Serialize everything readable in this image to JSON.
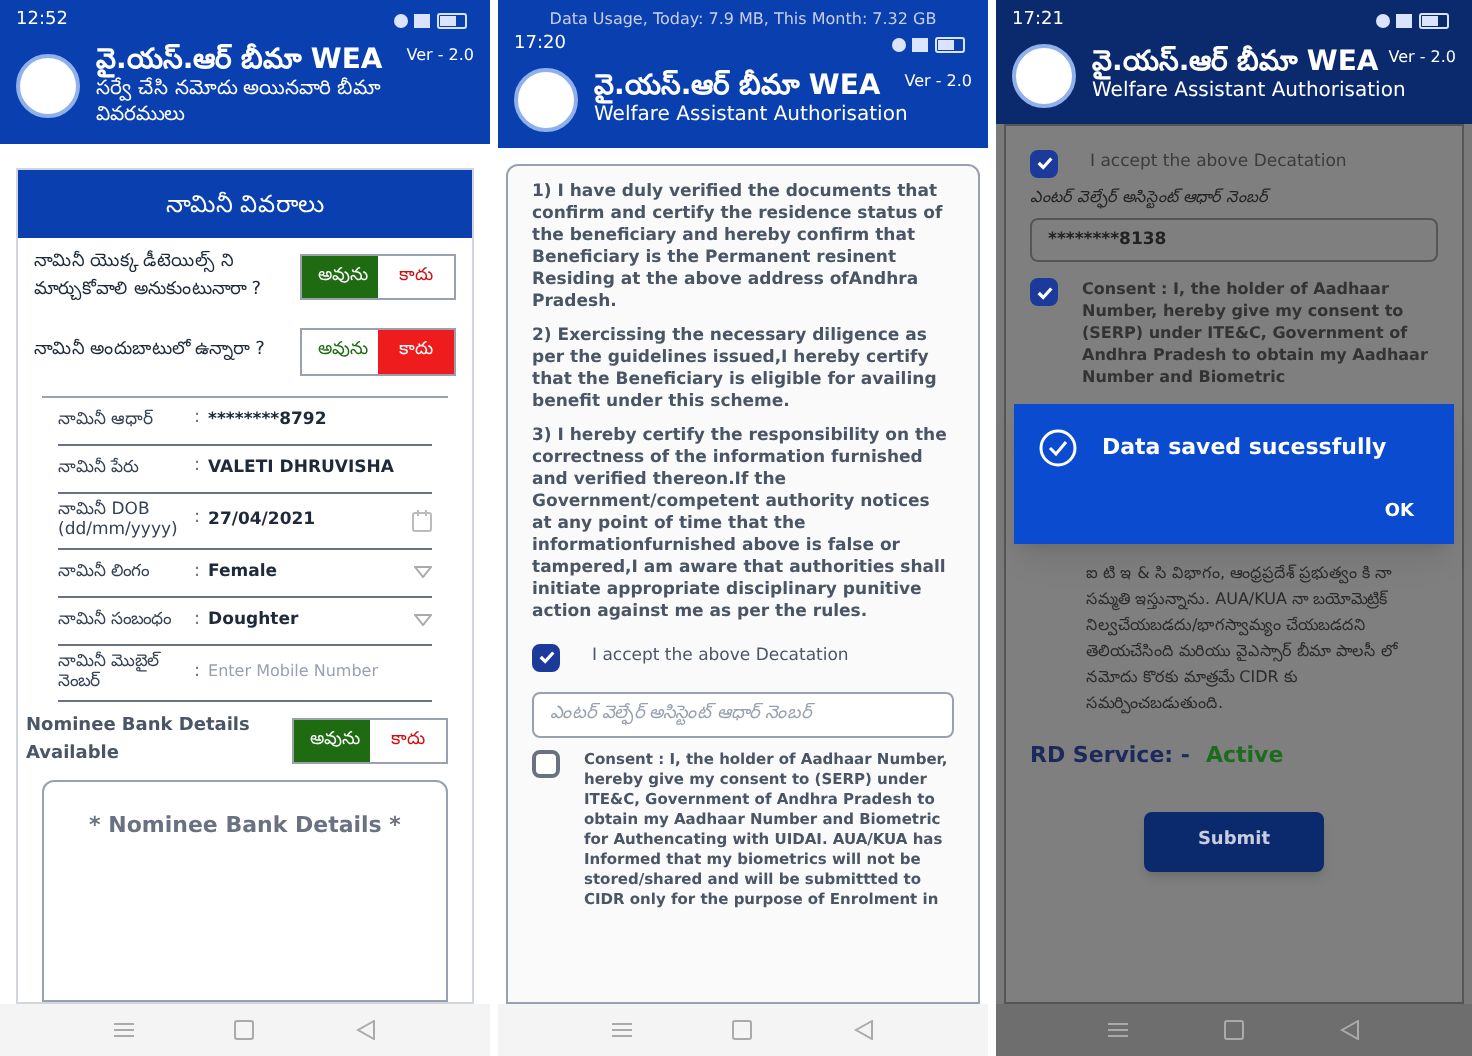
{
  "nominee_screen": {
    "status_time": "12:52",
    "header": {
      "title": "వై.యస్.ఆర్ బీమా WEA",
      "version": "Ver - 2.0",
      "subtitle": "సర్వే చేసి నమోదు అయినవారి బీమా వివరములు"
    },
    "card_title": "నామినీ వివరాలు",
    "questions": [
      {
        "text": "నామినీ యొక్క డీటెయిల్స్ ని మార్చుకోవాలి అనుకుంటునారా ?",
        "options": [
          {
            "label": "అవును",
            "kind": "yes",
            "selected": true
          },
          {
            "label": "కాదు",
            "kind": "no",
            "selected": false
          }
        ]
      },
      {
        "text": "నామినీ అందుబాటులో ఉన్నారా ?",
        "options": [
          {
            "label": "అవును",
            "kind": "yes",
            "selected": false
          },
          {
            "label": "కాదు",
            "kind": "no",
            "selected": true
          }
        ]
      }
    ],
    "fields": [
      {
        "label": "నామినీ ఆధార్",
        "separator": ":",
        "kind": "text",
        "value": "********8792"
      },
      {
        "label": "నామినీ పేరు",
        "separator": ":",
        "kind": "text",
        "value": "VALETI DHRUVISHA"
      },
      {
        "label": "నామినీ DOB (dd/mm/yyyy)",
        "separator": ":",
        "kind": "date",
        "value": "27/04/2021"
      },
      {
        "label": "నామినీ లింగం",
        "separator": ":",
        "kind": "dropdown",
        "value": "Female"
      },
      {
        "label": "నామినీ సంబంధం",
        "separator": ":",
        "kind": "dropdown",
        "value": "Doughter"
      },
      {
        "label": "నామినీ మొబైల్ నెంబర్",
        "separator": ":",
        "kind": "input",
        "placeholder": "Enter Mobile Number"
      }
    ],
    "bank_question": {
      "text": "Nominee Bank Details Available",
      "options": [
        {
          "label": "అవును",
          "kind": "yes",
          "selected": true
        },
        {
          "label": "కాదు",
          "kind": "no",
          "selected": false
        }
      ]
    },
    "bank_section_title": "* Nominee Bank Details *"
  },
  "declaration_screen": {
    "notification": "Data Usage, Today: 7.9 MB, This Month: 7.32 GB",
    "status_time": "17:20",
    "header": {
      "title": "వై.యస్.ఆర్ బీమా WEA",
      "version": "Ver - 2.0",
      "subtitle": "Welfare Assistant Authorisation"
    },
    "paragraphs": [
      "1) I have duly verified the documents that confirm and certify the residence status of the beneficiary and hereby confirm that Beneficiary is the Permanent resinent Residing at the above address ofAndhra Pradesh.",
      "2) Exercissing the necessary diligence as per the guidelines issued,I hereby certify that the Beneficiary is eligible for availing benefit under this scheme.",
      "3) I hereby certify the responsibility on the correctness of the information furnished and verified thereon.If the Government/competent authority notices at any point of time that the informationfurnished above is false or tampered,I am aware that authorities shall initiate appropriate disciplinary punitive action against me as per the rules."
    ],
    "accept": {
      "label": "I accept the above Decatation",
      "checked": true
    },
    "aadhaar_field": {
      "placeholder": "ఎంటర్ వెల్ఫేర్ అసిస్టెంట్ ఆధార్ నెంబర్"
    },
    "consent": {
      "text": "Consent : I, the holder of Aadhaar Number, hereby give my consent to (SERP) under ITE&C, Government of Andhra Pradesh to obtain my Aadhaar Number and Biometric for Authencating with UIDAI. AUA/KUA has Informed that my biometrics will not be stored/shared and will be submittted to CIDR only for the purpose of Enrolment in",
      "checked": false
    }
  },
  "saved_screen": {
    "status_time": "17:21",
    "header": {
      "title": "వై.యస్.ఆర్ బీమా WEA",
      "version": "Ver - 2.0",
      "subtitle": "Welfare Assistant Authorisation"
    },
    "accept": {
      "label": "I accept the above Decatation",
      "checked": true
    },
    "aadhaar_label": "ఎంటర్ వెల్ఫేర్ అసిస్టెంట్ ఆధార్ నెంబర్",
    "aadhaar_value": "********8138",
    "consent": {
      "text": "Consent : I, the holder of Aadhaar Number, hereby give my consent to (SERP) under ITE&C, Government of Andhra Pradesh to obtain my Aadhaar Number and Biometric",
      "checked": true
    },
    "dialog": {
      "message": "Data saved sucessfully",
      "button": "OK"
    },
    "consent_telugu": "ఐ టి ఇ & సి విభాగం, ఆంధ్రప్రదేశ్ ప్రభుత్వం కి నా సమ్మతి ఇస్తున్నాను. AUA/KUA నా బయోమెట్రిక్ నిల్వచేయబడదు/భాగస్వామ్యం చేయబడదని తెలియచేసింది మరియు వైఎస్సార్ బీమా పాలసీ లో నమోదు కొరకు మాత్రమే CIDR కు సమర్పించబడుతుంది.",
    "rd_service": {
      "label": "RD Service: -",
      "status": "Active"
    },
    "submit": "Submit"
  }
}
